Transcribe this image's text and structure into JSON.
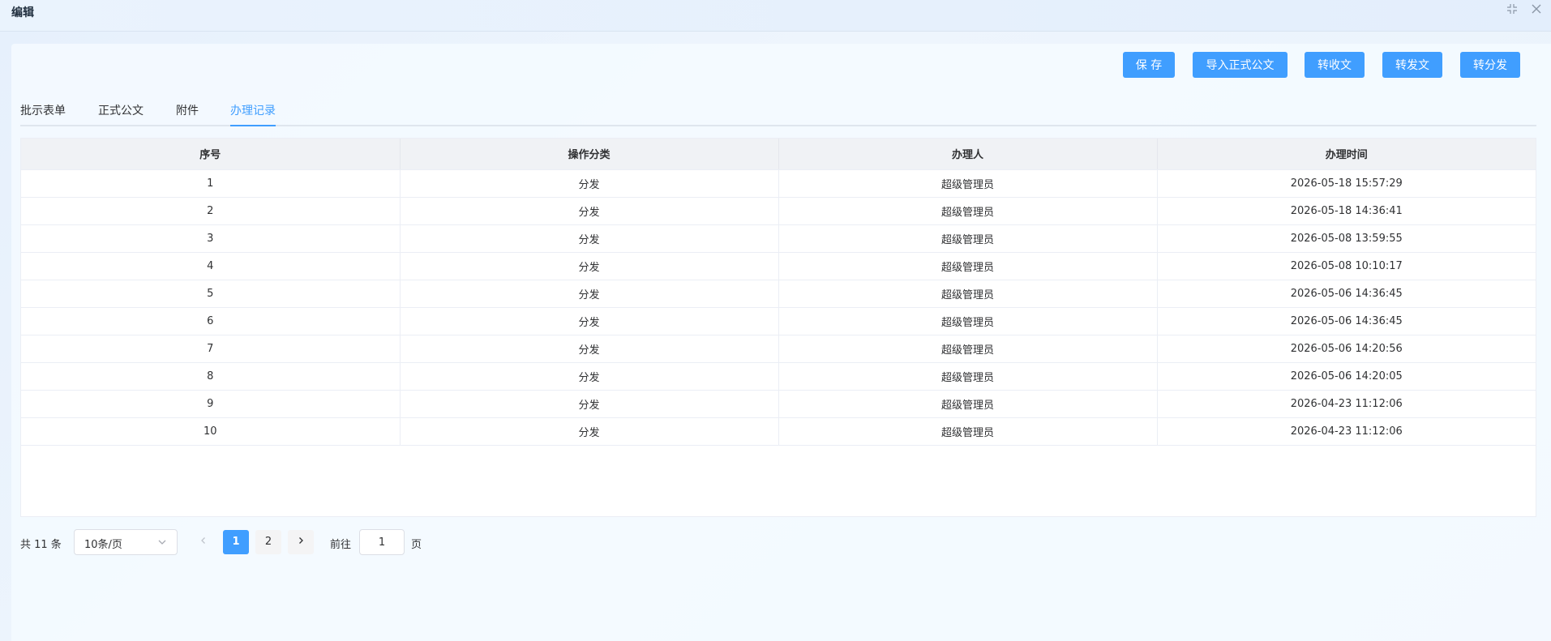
{
  "dialog": {
    "title": "编辑"
  },
  "toolbar": {
    "save": "保 存",
    "import_doc": "导入正式公文",
    "to_receive": "转收文",
    "to_send": "转发文",
    "to_distribute": "转分发"
  },
  "tabs": [
    {
      "label": "批示表单",
      "active": false
    },
    {
      "label": "正式公文",
      "active": false
    },
    {
      "label": "附件",
      "active": false
    },
    {
      "label": "办理记录",
      "active": true
    }
  ],
  "table": {
    "columns": [
      "序号",
      "操作分类",
      "办理人",
      "办理时间"
    ],
    "rows": [
      [
        "1",
        "分发",
        "超级管理员",
        "2026-05-18 15:57:29"
      ],
      [
        "2",
        "分发",
        "超级管理员",
        "2026-05-18 14:36:41"
      ],
      [
        "3",
        "分发",
        "超级管理员",
        "2026-05-08 13:59:55"
      ],
      [
        "4",
        "分发",
        "超级管理员",
        "2026-05-08 10:10:17"
      ],
      [
        "5",
        "分发",
        "超级管理员",
        "2026-05-06 14:36:45"
      ],
      [
        "6",
        "分发",
        "超级管理员",
        "2026-05-06 14:36:45"
      ],
      [
        "7",
        "分发",
        "超级管理员",
        "2026-05-06 14:20:56"
      ],
      [
        "8",
        "分发",
        "超级管理员",
        "2026-05-06 14:20:05"
      ],
      [
        "9",
        "分发",
        "超级管理员",
        "2026-04-23 11:12:06"
      ],
      [
        "10",
        "分发",
        "超级管理员",
        "2026-04-23 11:12:06"
      ]
    ]
  },
  "pagination": {
    "total_text": "共 11 条",
    "page_size": "10条/页",
    "pages": [
      "1",
      "2"
    ],
    "current_page": "1",
    "goto_label": "前往",
    "goto_value": "1",
    "goto_suffix": "页"
  },
  "colors": {
    "accent": "#409eff"
  }
}
